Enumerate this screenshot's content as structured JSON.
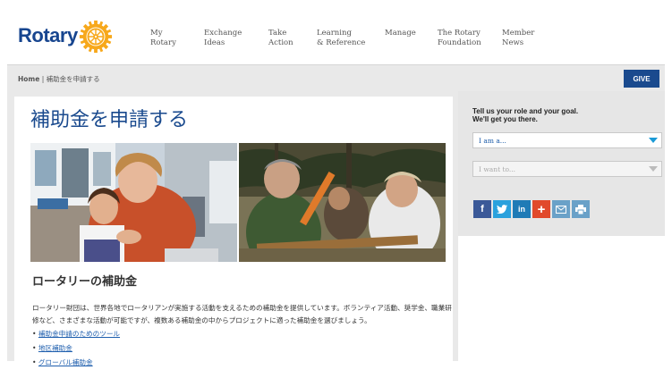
{
  "header": {
    "logo_text": "Rotary",
    "nav": [
      {
        "label": "My\nRotary"
      },
      {
        "label": "Exchange\nIdeas"
      },
      {
        "label": "Take\nAction"
      },
      {
        "label": "Learning\n& Reference"
      },
      {
        "label": "Manage"
      },
      {
        "label": "The Rotary\nFoundation"
      },
      {
        "label": "Member\nNews"
      }
    ]
  },
  "breadcrumb": {
    "home": "Home",
    "separator": " | ",
    "current": "補助金を申請する"
  },
  "give_button": "GIVE",
  "main": {
    "title": "補助金を申請する",
    "section_title": "ロータリーの補助金",
    "body": "ロータリー財団は、世界各地でロータリアンが実施する活動を支えるための補助金を提供しています。ボランティア活動、奨学金、職業研修など、さまざまな活動が可能ですが、複数ある補助金の中からプロジェクトに適った補助金を選びましょう。",
    "links": [
      "補助金申請のためのツール",
      "地区補助金",
      "グローバル補助金"
    ]
  },
  "side": {
    "title": "Tell us your role and your goal.\nWe'll get you there.",
    "select_role": "I am a...",
    "select_goal": "I want to..."
  },
  "social": [
    {
      "icon": "facebook-icon",
      "glyph": "f",
      "color": "#3b5998"
    },
    {
      "icon": "twitter-icon",
      "glyph": "t",
      "color": "#2aa1dd"
    },
    {
      "icon": "linkedin-icon",
      "glyph": "in",
      "color": "#1f7bb6"
    },
    {
      "icon": "google-plus-icon",
      "glyph": "+",
      "color": "#e14a2c"
    },
    {
      "icon": "email-icon",
      "glyph": "✉",
      "color": "#6aa1c8"
    },
    {
      "icon": "print-icon",
      "glyph": "⎙",
      "color": "#6aa1c8"
    }
  ],
  "colors": {
    "brand_blue": "#17458f",
    "gold": "#f7a81b",
    "link": "#1f5fae"
  }
}
